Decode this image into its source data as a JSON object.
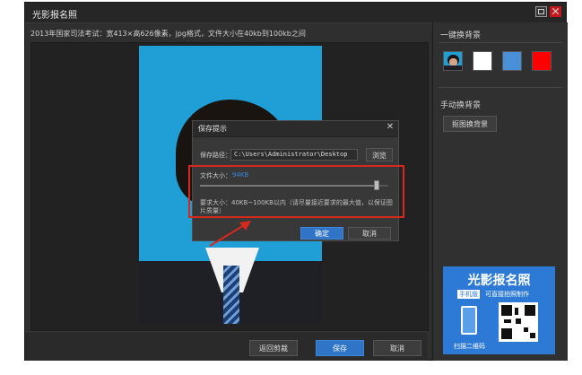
{
  "window": {
    "title": "光影报名照",
    "info_text": "2013年国家司法考试：宽413×高626像素，jpg格式，文件大小在40kb到100kb之间"
  },
  "bottom_bar": {
    "crop_back": "返回剪裁",
    "save": "保存",
    "cancel": "取消"
  },
  "sidebar": {
    "one_click_title": "一键换背景",
    "swatches": [
      "#ffffff",
      "#4a90d9",
      "#ff0000"
    ],
    "manual_title": "手动换背景",
    "cutout_button": "抠图换背景"
  },
  "ad": {
    "title": "光影报名照",
    "tag": "手机版",
    "subtitle": "可直接拍照制作",
    "scan": "扫描二维码"
  },
  "dialog": {
    "title": "保存提示",
    "path_label": "保存路径：",
    "path_value": "C:\\Users\\Administrator\\Desktop",
    "browse": "浏览",
    "size_label": "文件大小：",
    "size_value": "94KB",
    "slider_fraction": 0.94,
    "requirement": "要求大小：40KB~100KB以内（请尽量接近要求的最大值，以保证图片质量）",
    "ok": "确定",
    "cancel": "取消"
  },
  "colors": {
    "accent": "#2f74c7",
    "highlight": "#d8281e"
  }
}
